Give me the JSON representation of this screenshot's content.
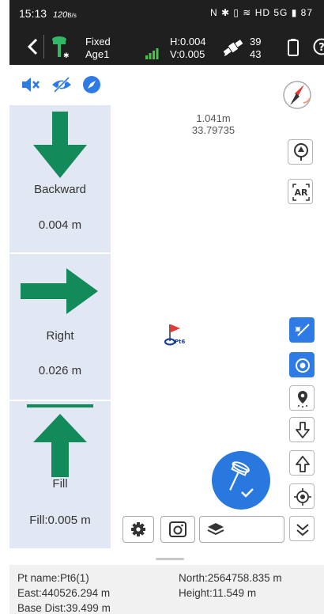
{
  "status_bar": {
    "time": "15:13",
    "speed": "120",
    "speed_unit": "B/s",
    "icons_text": "N ✱ ▯ ≋ HD 5G ▮ 87"
  },
  "header": {
    "fix_status": "Fixed",
    "age": "Age1",
    "h_precision": "H:0.004",
    "v_precision": "V:0.005",
    "satellites_tracked": "39",
    "satellites_used": "43"
  },
  "toolbar": {
    "icons": [
      "mute-icon",
      "hide-eye-icon",
      "compass-icon"
    ]
  },
  "guidance": {
    "backward_label": "Backward",
    "backward_value": "0.004 m",
    "right_label": "Right",
    "right_value": "0.026 m",
    "fill_label": "Fill",
    "fill_value": "Fill:0.005 m"
  },
  "map": {
    "distance": "1.041m",
    "bearing": "33.79735",
    "target_label": "Pt6"
  },
  "right_tools": {
    "ar_label": "AR"
  },
  "info": {
    "pt_name": "Pt name:Pt6(1)",
    "north": "North:2564758.835 m",
    "east": "East:440526.294 m",
    "height": "Height:11.549 m",
    "base_dist": "Base Dist:39.499 m"
  },
  "colors": {
    "arrow_green": "#138a5a",
    "panel_bg": "#e1e7f3",
    "accent_blue": "#2f7be5",
    "topbar": "#1f1f1f"
  }
}
